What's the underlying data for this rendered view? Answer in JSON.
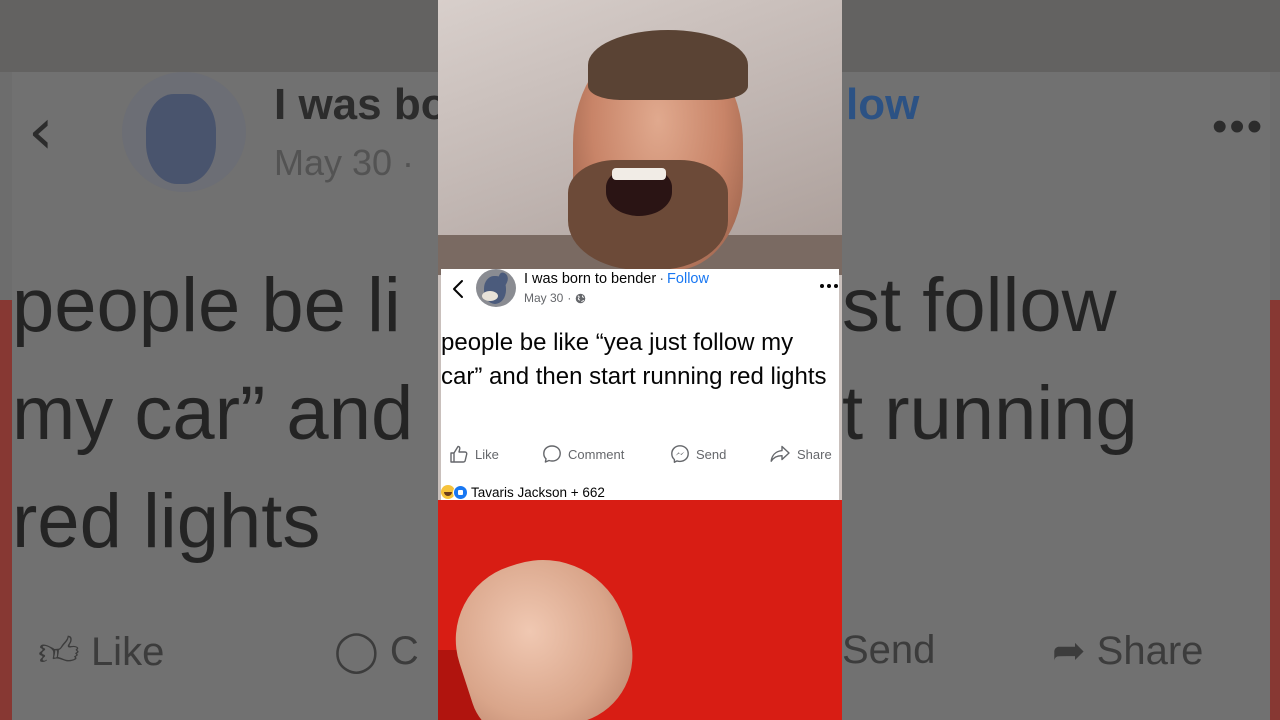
{
  "post": {
    "author": "I was born to bender",
    "separator": "·",
    "follow_label": "Follow",
    "date": "May 30",
    "date_separator": "·",
    "privacy_icon": "globe-icon",
    "text": "people be like “yea just follow my car” and then start running red lights",
    "actions": {
      "like": "Like",
      "comment": "Comment",
      "send": "Send",
      "share": "Share"
    },
    "reactions": {
      "summary": "Tavaris Jackson + 662",
      "types": [
        "haha",
        "like"
      ]
    }
  },
  "background": {
    "name_fragment": "I was bo",
    "follow_fragment": "low",
    "date_fragment": "May 30 ·",
    "text_lines": [
      "people be li",
      "my car” and",
      "red lights"
    ],
    "text_lines_right": [
      "st follow",
      "t running"
    ],
    "actions": {
      "like": "Like",
      "comment_fragment": "C",
      "send_fragment": "Send",
      "share": "Share"
    }
  },
  "colors": {
    "follow": "#1877f2",
    "reaction_like": "#1877f2",
    "reaction_haha": "#f7c33b",
    "shirt_red": "#d81d14"
  }
}
